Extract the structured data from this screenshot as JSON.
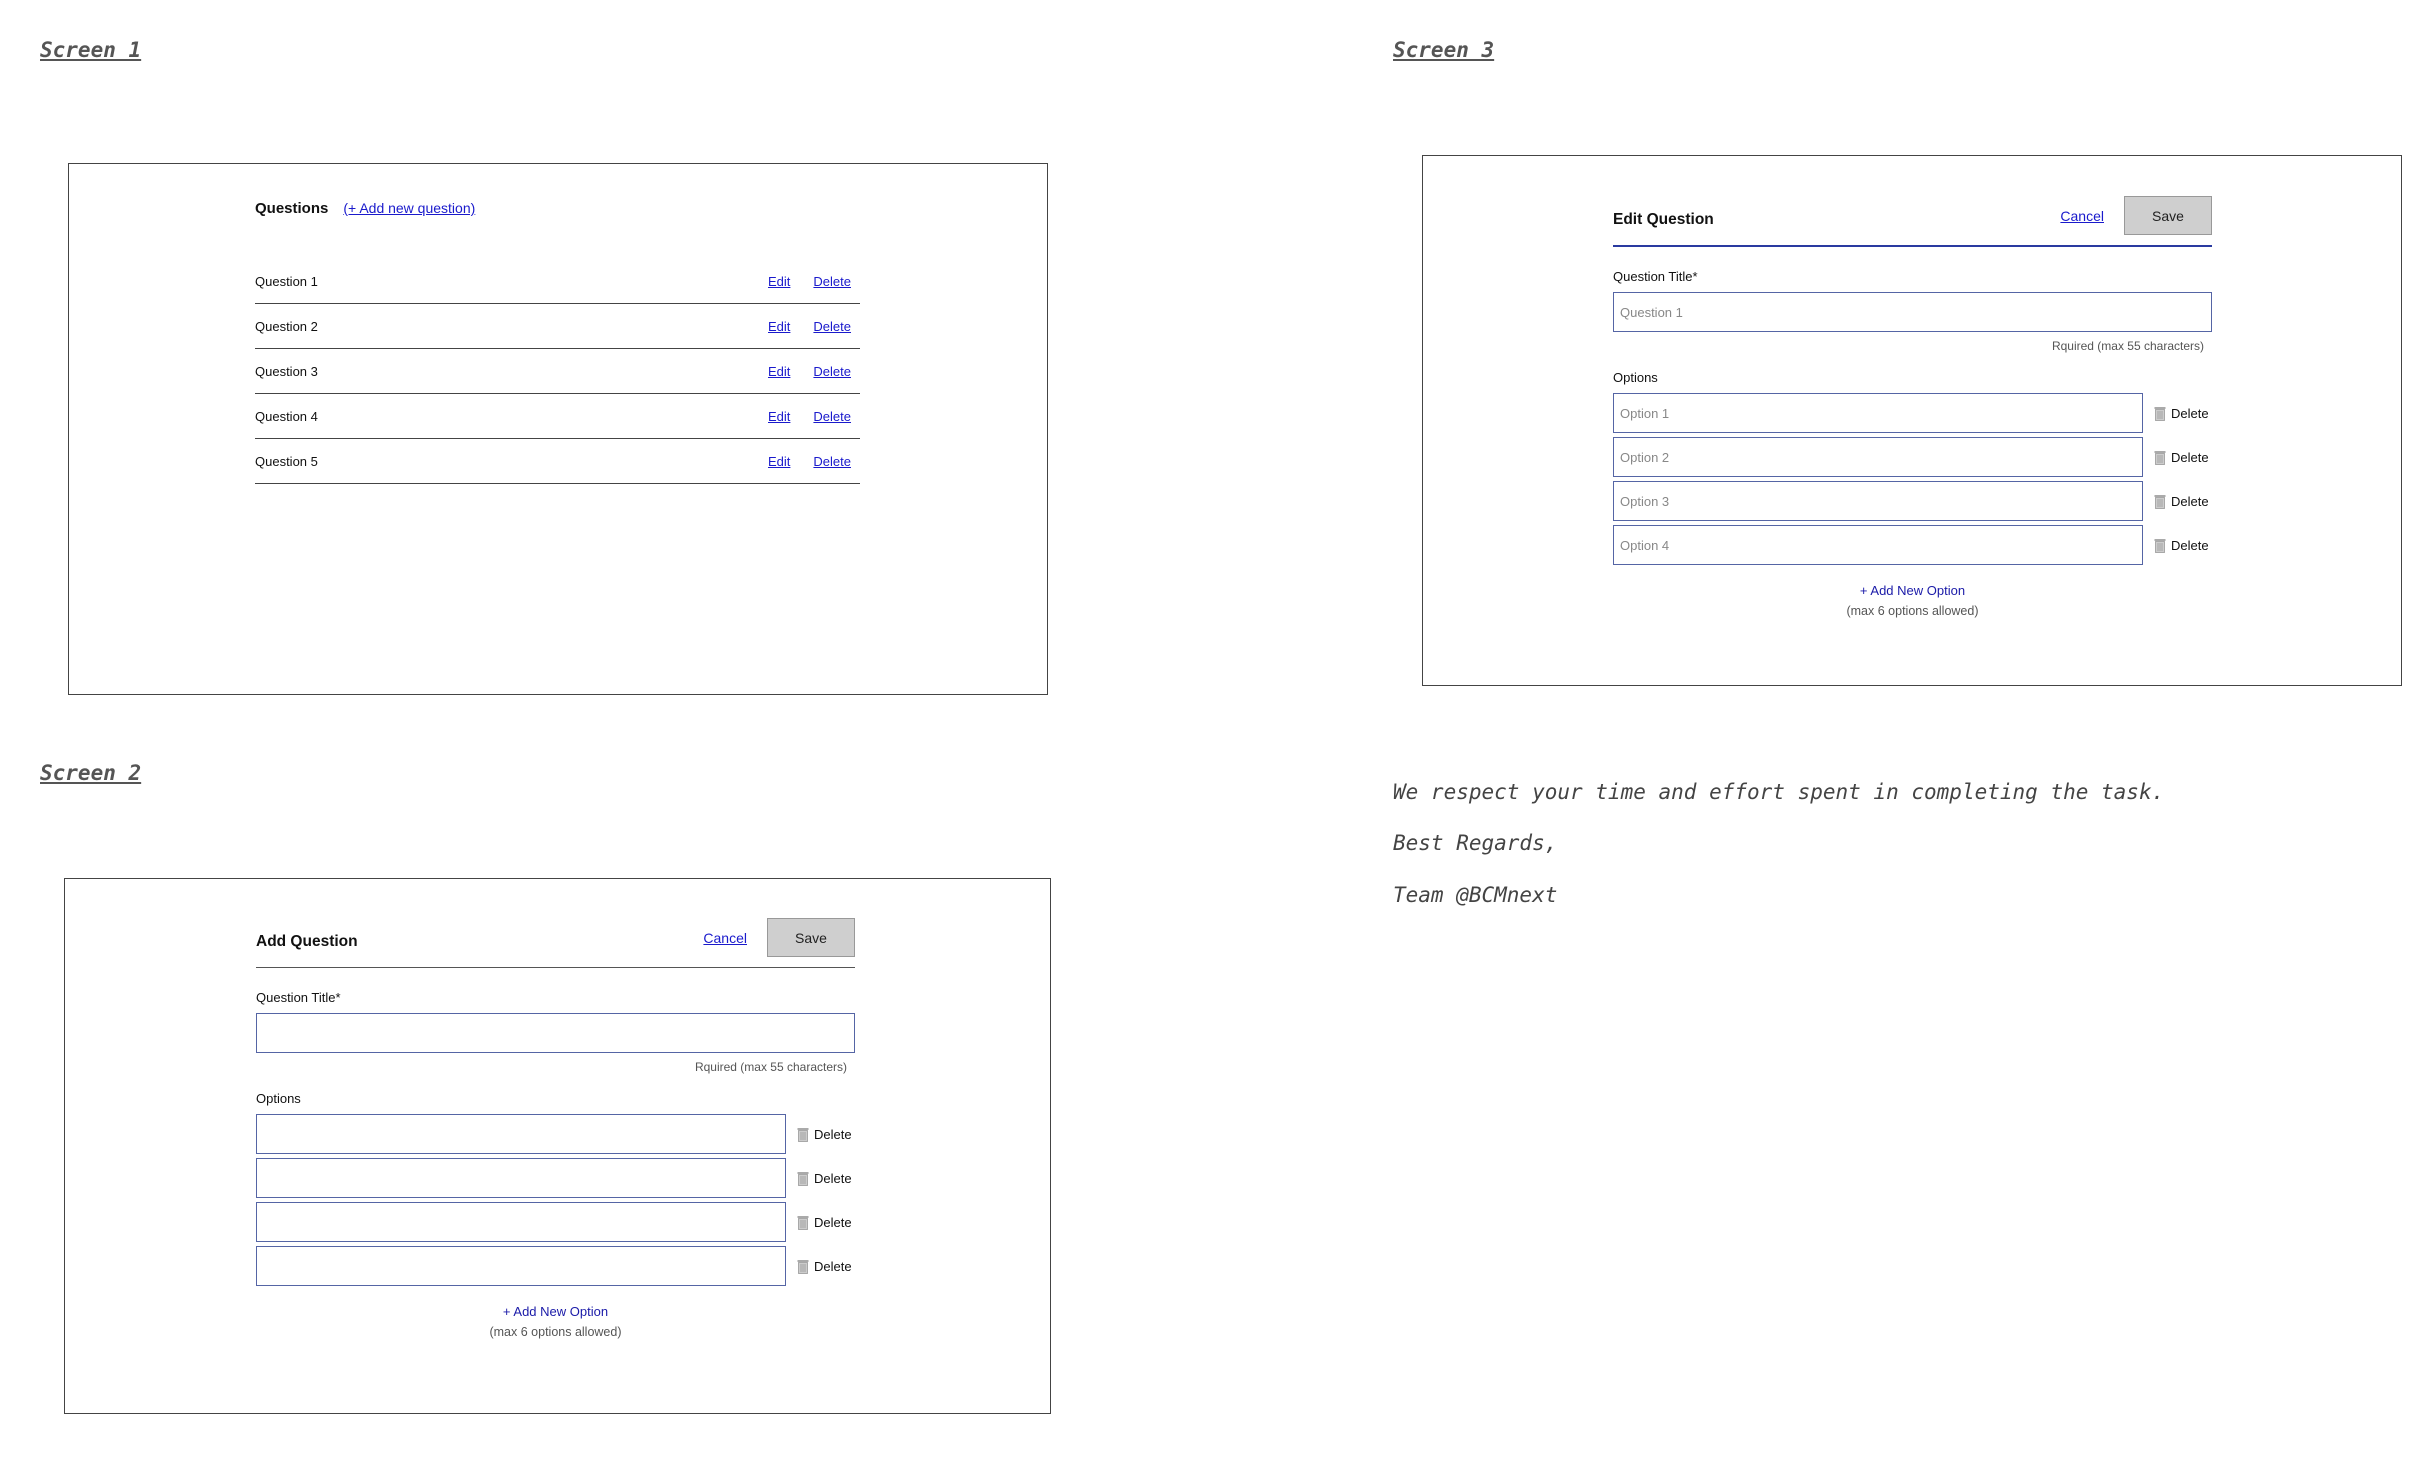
{
  "labels": {
    "screen1": "Screen 1",
    "screen2": "Screen 2",
    "screen3": "Screen 3"
  },
  "screen1": {
    "title": "Questions",
    "add_link": "(+ Add new question)",
    "edit_label": "Edit",
    "delete_label": "Delete",
    "questions": [
      "Question 1",
      "Question 2",
      "Question 3",
      "Question 4",
      "Question 5"
    ]
  },
  "screen2": {
    "title": "Add Question",
    "cancel": "Cancel",
    "save": "Save",
    "title_label": "Question Title*",
    "title_value": "",
    "hint": "Rquired (max 55 characters)",
    "options_label": "Options",
    "options": [
      "",
      "",
      "",
      ""
    ],
    "delete_label": "Delete",
    "add_option": "+ Add New Option",
    "max_options": "(max 6 options allowed)"
  },
  "screen3": {
    "title": "Edit Question",
    "cancel": "Cancel",
    "save": "Save",
    "title_label": "Question Title*",
    "title_value": "Question 1",
    "hint": "Rquired (max 55 characters)",
    "options_label": "Options",
    "options": [
      "Option 1",
      "Option 2",
      "Option 3",
      "Option 4"
    ],
    "delete_label": "Delete",
    "add_option": "+ Add New Option",
    "max_options": "(max 6 options allowed)"
  },
  "message": {
    "line1": "We respect your time and effort spent in completing the task.",
    "line2": "Best Regards,",
    "line3": "Team @BCMnext"
  },
  "icons": {
    "delete": "trash-icon"
  },
  "colors": {
    "link": "#1a1acc",
    "input_border": "#5565a5",
    "save_button": "#cfcfcf",
    "edit_underline": "#2a3aa0"
  }
}
